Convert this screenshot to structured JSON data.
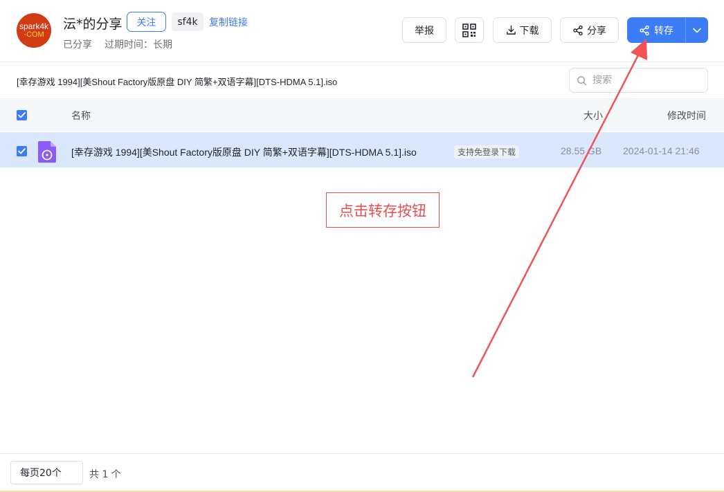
{
  "header": {
    "avatar": {
      "line1": "spark4k",
      "line2": "·COM"
    },
    "user_name": "沄*的分享",
    "follow_label": "关注",
    "code": "sf4k",
    "copy_link_label": "复制链接",
    "shared_label": "已分享",
    "expire_label": "过期时间：长期",
    "actions": {
      "report": "举报",
      "download": "下载",
      "share": "分享",
      "save": "转存"
    }
  },
  "share_title": "[幸存游戏 1994][美Shout Factory版原盘 DIY 简繁+双语字幕][DTS-HDMA 5.1].iso",
  "search": {
    "placeholder": "搜索"
  },
  "table": {
    "columns": {
      "name": "名称",
      "size": "大小",
      "mtime": "修改时间"
    },
    "rows": [
      {
        "name": "[幸存游戏 1994][美Shout Factory版原盘 DIY 简繁+双语字幕][DTS-HDMA 5.1].iso",
        "badge": "支持免登录下载",
        "size": "28.55 GB",
        "mtime": "2024-01-14 21:46",
        "checked": true
      }
    ]
  },
  "annotation": {
    "text": "点击转存按钮",
    "color": "#e84e4e"
  },
  "footer": {
    "page_size": "每页20个",
    "total": "共 1 个"
  },
  "colors": {
    "accent": "#3c7cf5",
    "row_selected": "#dbe7fd",
    "file_icon": "#8b5cf6"
  }
}
